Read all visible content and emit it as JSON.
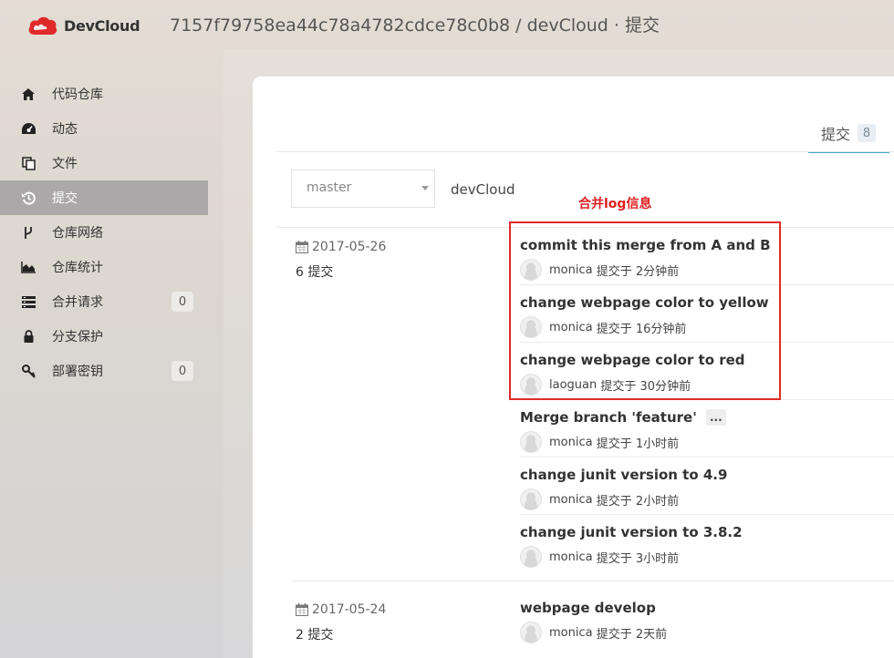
{
  "header": {
    "logo_text": "DevCloud",
    "title": "7157f79758ea44c78a4782cdce78c0b8 / devCloud · 提交"
  },
  "sidebar": {
    "items": [
      {
        "label": "代码仓库",
        "icon": "home-icon"
      },
      {
        "label": "动态",
        "icon": "dashboard-icon"
      },
      {
        "label": "文件",
        "icon": "files-icon"
      },
      {
        "label": "提交",
        "icon": "history-icon",
        "active": true
      },
      {
        "label": "仓库网络",
        "icon": "branch-icon"
      },
      {
        "label": "仓库统计",
        "icon": "area-chart-icon"
      },
      {
        "label": "合并请求",
        "icon": "list-icon",
        "badge": "0"
      },
      {
        "label": "分支保护",
        "icon": "lock-icon"
      },
      {
        "label": "部署密钥",
        "icon": "key-icon",
        "badge": "0"
      }
    ]
  },
  "tabs": {
    "commits_label": "提交",
    "commits_count": "8"
  },
  "toolbar": {
    "branch": "master",
    "repo": "devCloud"
  },
  "annotation": {
    "label": "合并log信息",
    "color": "#e02020"
  },
  "groups": [
    {
      "date": "2017-05-26",
      "count": "6 提交",
      "commits": [
        {
          "message": "commit this merge from A and B",
          "author": "monica",
          "verb": "提交于",
          "time": "2分钟前"
        },
        {
          "message": "change webpage color to yellow",
          "author": "monica",
          "verb": "提交于",
          "time": "16分钟前"
        },
        {
          "message": "change webpage color to red",
          "author": "laoguan",
          "verb": "提交于",
          "time": "30分钟前"
        },
        {
          "message": "Merge branch 'feature'",
          "author": "monica",
          "verb": "提交于",
          "time": "1小时前",
          "more": "..."
        },
        {
          "message": "change junit version to 4.9",
          "author": "monica",
          "verb": "提交于",
          "time": "2小时前"
        },
        {
          "message": "change junit version to 3.8.2",
          "author": "monica",
          "verb": "提交于",
          "time": "3小时前"
        }
      ]
    },
    {
      "date": "2017-05-24",
      "count": "2 提交",
      "commits": [
        {
          "message": "webpage develop",
          "author": "monica",
          "verb": "提交于",
          "time": "2天前"
        }
      ]
    }
  ],
  "colors": {
    "accent": "#3fa9c9",
    "brand": "#e02a2a",
    "sidebar_active": "#aaa8a8"
  }
}
